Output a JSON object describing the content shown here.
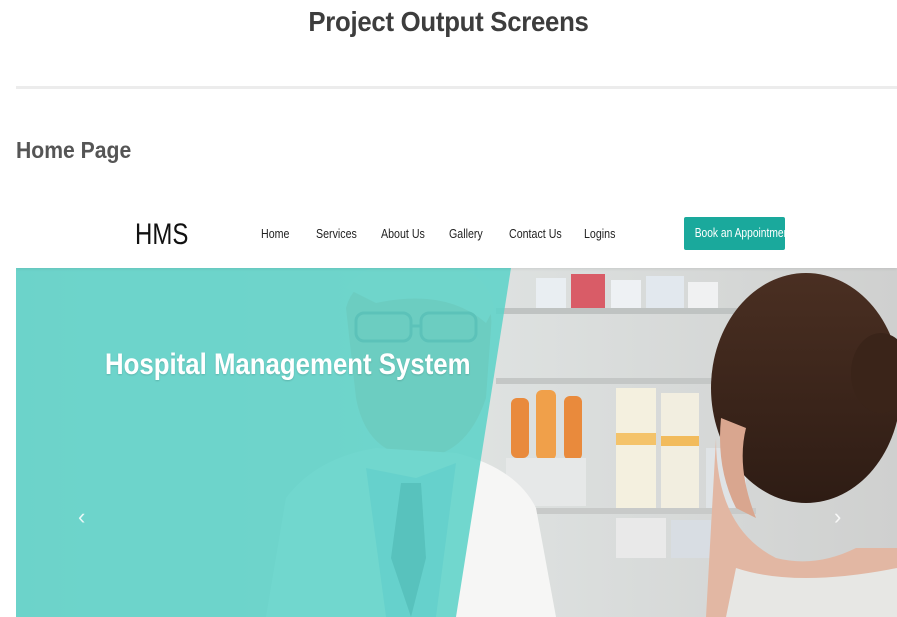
{
  "document": {
    "title": "Project Output Screens",
    "section_heading": "Home Page"
  },
  "app": {
    "brand": "HMS",
    "nav": {
      "items": [
        {
          "label": "Home"
        },
        {
          "label": "Services"
        },
        {
          "label": "About Us"
        },
        {
          "label": "Gallery"
        },
        {
          "label": "Contact Us"
        },
        {
          "label": "Logins"
        }
      ],
      "cta_label": "Book an Appointment"
    },
    "hero": {
      "title": "Hospital Management System",
      "prev_glyph": "‹",
      "next_glyph": "›",
      "prev_icon": "chevron-left-icon",
      "next_icon": "chevron-right-icon"
    }
  },
  "colors": {
    "accent": "#1aa99c",
    "overlay": "#5fd3c8",
    "title_text": "#3d3d3d",
    "heading_text": "#555555"
  }
}
